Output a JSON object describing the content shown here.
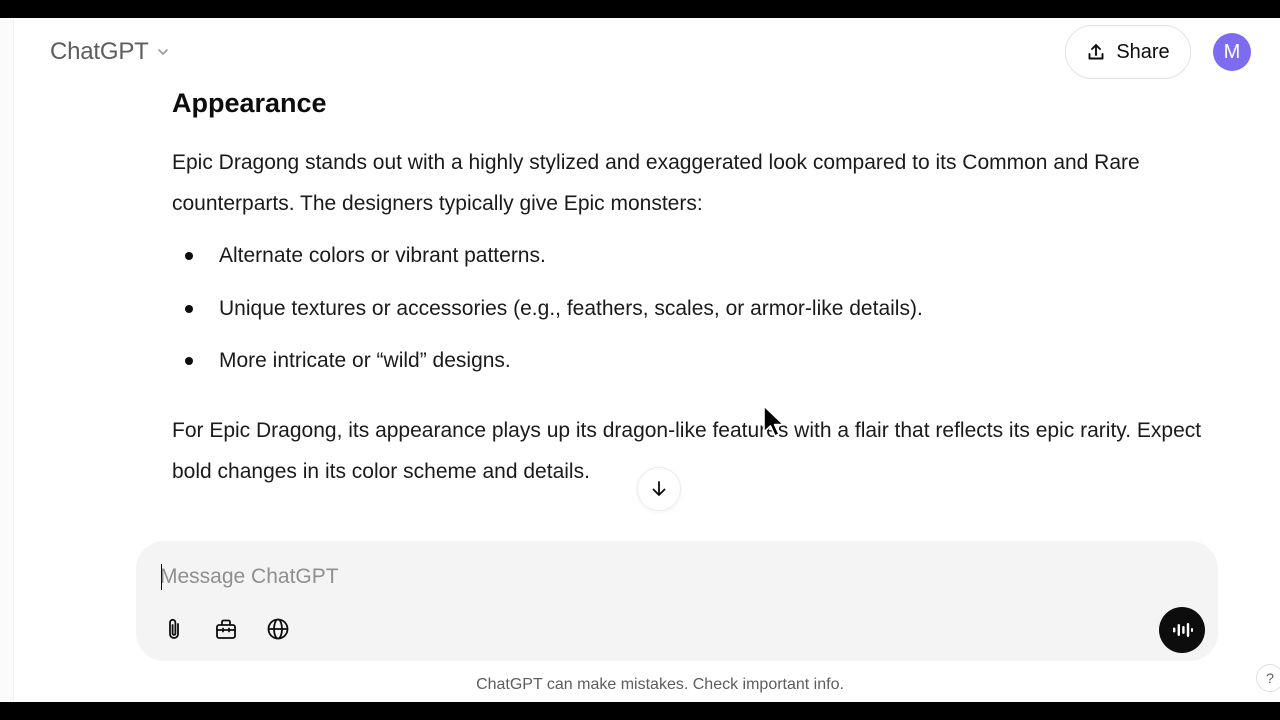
{
  "header": {
    "model_name": "ChatGPT",
    "share_label": "Share",
    "avatar_initial": "M"
  },
  "message": {
    "heading": "Appearance",
    "paragraph1": "Epic Dragong stands out with a highly stylized and exaggerated look compared to its Common and Rare counterparts. The designers typically give Epic monsters:",
    "bullets": [
      "Alternate colors or vibrant patterns.",
      "Unique textures or accessories (e.g., feathers, scales, or armor-like details).",
      "More intricate or “wild” designs."
    ],
    "paragraph2": "For Epic Dragong, its appearance plays up its dragon-like features with a flair that reflects its epic rarity. Expect bold changes in its color scheme and details."
  },
  "composer": {
    "placeholder": "Message ChatGPT",
    "value": ""
  },
  "icons": {
    "attach": "paperclip-icon",
    "tools": "toolbox-icon",
    "search": "globe-icon",
    "voice": "voice-mode-icon",
    "scroll": "arrow-down-icon",
    "share": "share-upload-icon"
  },
  "footer": {
    "disclaimer": "ChatGPT can make mistakes. Check important info.",
    "help": "?"
  },
  "colors": {
    "avatar": "#7d6bf0",
    "composer_bg": "#f4f4f4",
    "voice_button": "#0d0d0d"
  }
}
